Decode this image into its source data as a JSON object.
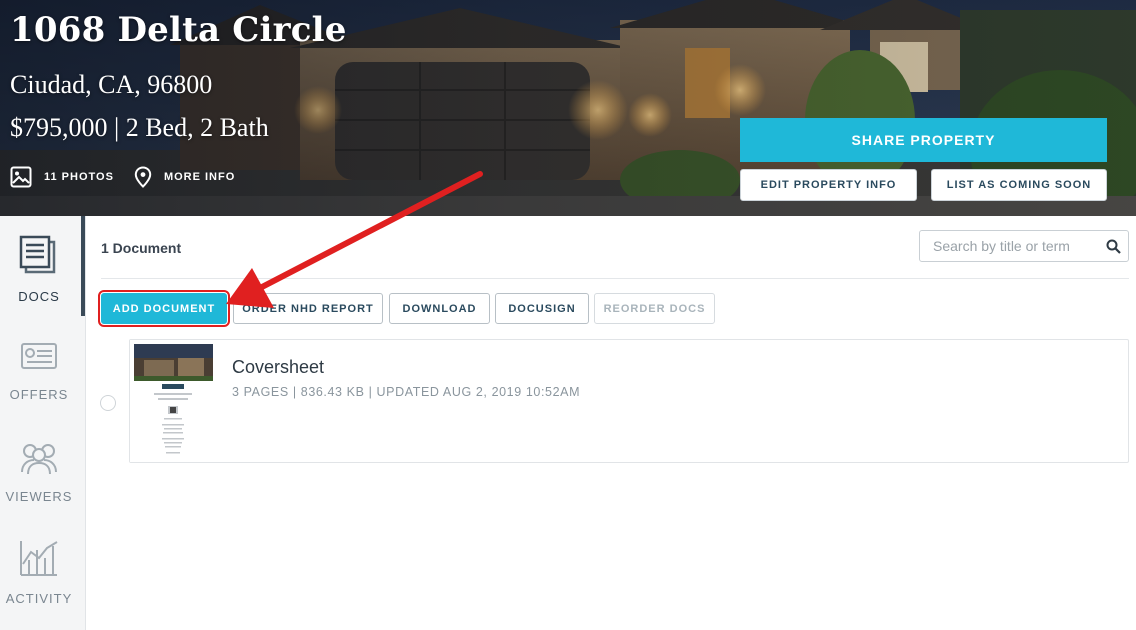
{
  "hero": {
    "title": "1068 Delta Circle",
    "address": "Ciudad, CA, 96800",
    "price_summary": "$795,000 | 2 Bed, 2 Bath",
    "photos_link": "11 PHOTOS",
    "more_info_link": "MORE INFO",
    "share_button": "SHARE PROPERTY",
    "edit_button": "EDIT PROPERTY INFO",
    "list_button": "LIST AS COMING SOON"
  },
  "sidebar": {
    "items": [
      {
        "label": "DOCS",
        "icon": "docs-icon",
        "active": true
      },
      {
        "label": "OFFERS",
        "icon": "offers-icon",
        "active": false
      },
      {
        "label": "VIEWERS",
        "icon": "viewers-icon",
        "active": false
      },
      {
        "label": "ACTIVITY",
        "icon": "activity-icon",
        "active": false
      }
    ]
  },
  "main": {
    "doc_count": "1 Document",
    "search_placeholder": "Search by title or term",
    "actions": {
      "add": "ADD DOCUMENT",
      "nhd": "ORDER NHD REPORT",
      "download": "DOWNLOAD",
      "docusign": "DOCUSIGN",
      "reorder": "REORDER DOCS"
    },
    "documents": [
      {
        "title": "Coversheet",
        "meta": "3 PAGES | 836.43 KB | UPDATED AUG 2, 2019 10:52AM"
      }
    ]
  },
  "colors": {
    "accent": "#1fb8d8",
    "highlight": "#e02020",
    "text_dark": "#2a4a5e"
  }
}
